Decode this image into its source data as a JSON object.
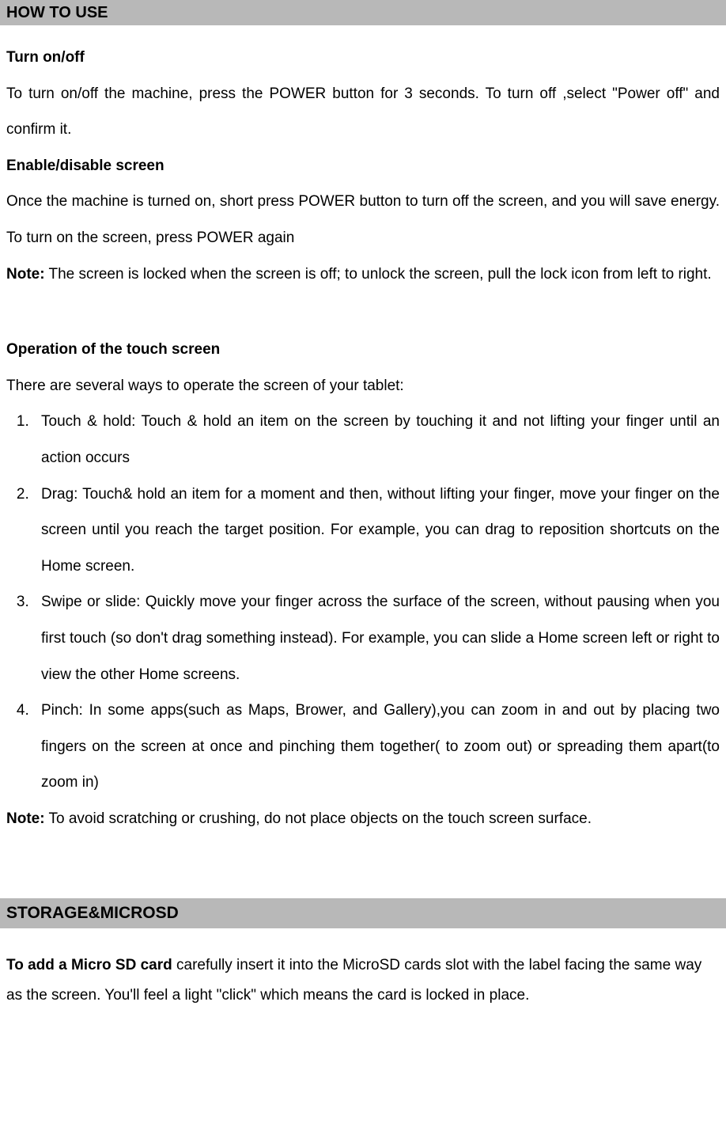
{
  "section1": {
    "header": "HOW TO USE",
    "sub1": "Turn on/off",
    "para1": "To turn on/off the machine, press the POWER button for 3 seconds. To turn off ,select \"Power off\" and confirm it.",
    "sub2": "Enable/disable screen",
    "para2": "Once the machine is turned on, short press POWER button to turn off the screen, and you will save energy. To turn on the screen, press POWER again",
    "noteLabel": "Note:",
    "noteText": " The screen is locked when the screen is off; to unlock the screen, pull the lock icon from left to right.",
    "sub3": "Operation of the touch screen",
    "para3": "There are several ways to operate the screen of your tablet:",
    "items": [
      "Touch & hold: Touch & hold an item on the screen by touching it and not lifting your finger until an action occurs",
      "Drag: Touch& hold an item for a moment and then, without lifting your finger, move your finger on the screen until you reach the target position. For example, you can drag to reposition shortcuts on the Home screen.",
      "Swipe or slide: Quickly move your finger across the surface of the screen, without pausing when you first touch (so don't drag something instead). For example, you can slide a Home screen left or right to view the other Home screens.",
      "Pinch: In some apps(such as Maps, Brower, and Gallery),you can zoom in and out by placing two fingers on the screen at once and pinching them together( to zoom out) or spreading them apart(to zoom in)"
    ],
    "note2Label": "Note:",
    "note2Text": " To avoid scratching or crushing, do not place objects on the touch screen surface."
  },
  "section2": {
    "header": "STORAGE&MICROSD",
    "boldLead": "To add a Micro SD card",
    "bodyText": " carefully insert it into the MicroSD cards slot with the label facing the same way as the screen. You'll feel a light \"click\" which means the card is locked in place."
  }
}
